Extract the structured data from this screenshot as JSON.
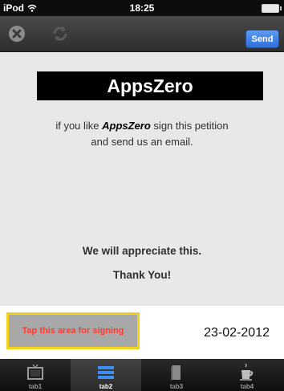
{
  "status": {
    "device": "iPod",
    "time": "18:25"
  },
  "nav": {
    "send_label": "Send"
  },
  "content": {
    "logo": "AppsZero",
    "petition_prefix": "if you like ",
    "petition_brand": "AppsZero",
    "petition_suffix": " sign this petition",
    "petition_line2": "and send us an email.",
    "appreciate": "We will appreciate this.",
    "thanks": "Thank You!"
  },
  "signing": {
    "label": "Tap this area for signing",
    "date": "23-02-2012"
  },
  "tabs": [
    {
      "label": "tab1",
      "icon": "tv-icon"
    },
    {
      "label": "tab2",
      "icon": "list-icon"
    },
    {
      "label": "tab3",
      "icon": "book-icon"
    },
    {
      "label": "tab4",
      "icon": "coffee-cup-icon"
    }
  ],
  "colors": {
    "accent": "#2f6fdb",
    "sign_border": "#f2d21b",
    "sign_text": "#ff3b30"
  }
}
